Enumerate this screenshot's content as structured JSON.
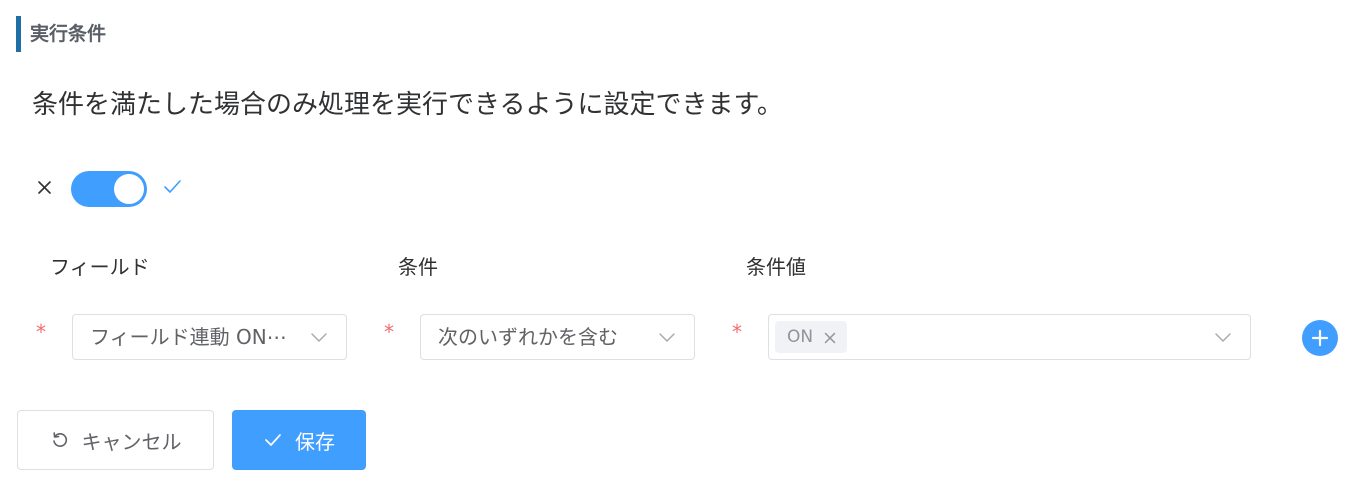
{
  "section": {
    "title": "実行条件"
  },
  "description": "条件を満たした場合のみ処理を実行できるように設定できます。",
  "toggle": {
    "state": "on",
    "off_icon": "close-icon",
    "on_icon": "check-icon"
  },
  "columns": {
    "field": "フィールド",
    "condition": "条件",
    "value": "条件値"
  },
  "condition_row": {
    "required_mark": "*",
    "field_select": "フィールド連動 ON⋯",
    "condition_select": "次のいずれかを含む",
    "value_tags": [
      "ON"
    ]
  },
  "buttons": {
    "cancel_label": "キャンセル",
    "save_label": "保存"
  },
  "colors": {
    "accent": "#409eff",
    "required": "#f56c6c",
    "section_bar": "#1f6fa6"
  }
}
